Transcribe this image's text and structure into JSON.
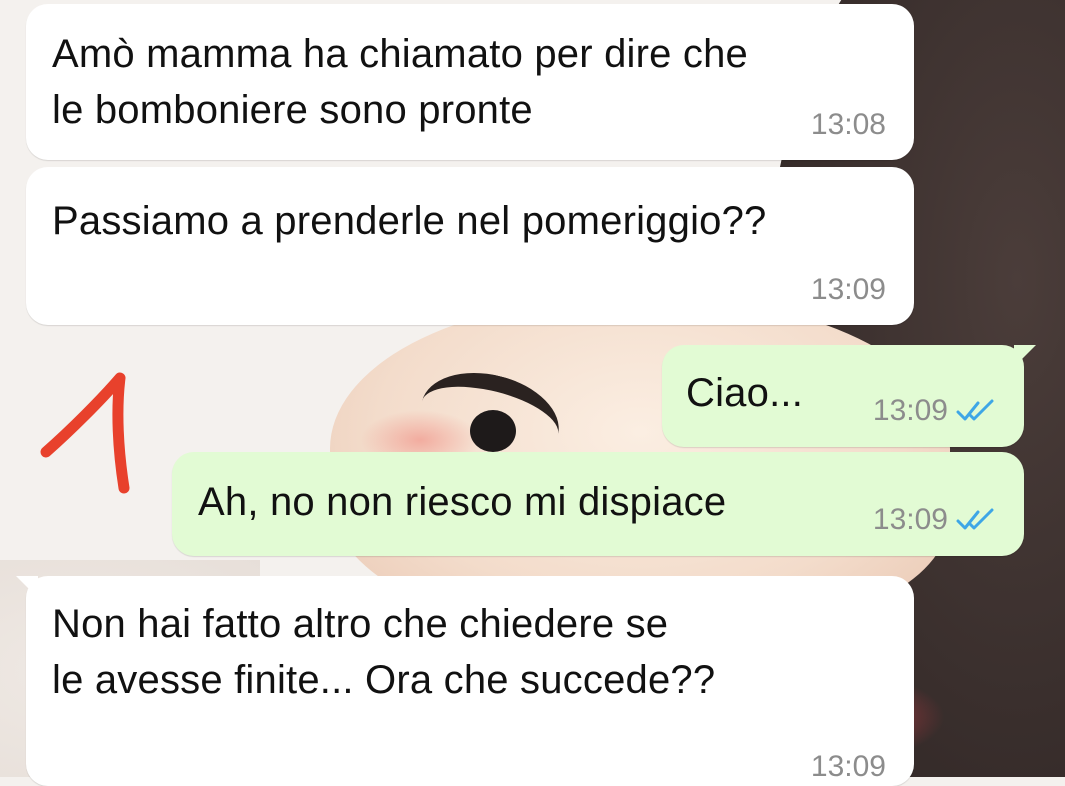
{
  "messages": [
    {
      "direction": "incoming",
      "text_line1": "Amò mamma ha chiamato per dire che",
      "text_line2": "le bomboniere sono pronte",
      "time": "13:08"
    },
    {
      "direction": "incoming",
      "text_line1": "Passiamo a prenderle nel pomeriggio??",
      "time": "13:09"
    },
    {
      "direction": "outgoing",
      "text_line1": "Ciao...",
      "time": "13:09",
      "status_icon": "double-check-read-icon"
    },
    {
      "direction": "outgoing",
      "text_line1": "Ah, no non riesco mi dispiace",
      "time": "13:09",
      "status_icon": "double-check-read-icon"
    },
    {
      "direction": "incoming",
      "text_line1": "Non hai fatto altro che chiedere se",
      "text_line2": "le avesse finite... Ora che succede??",
      "time": "13:09"
    }
  ],
  "annotation": {
    "text": "1",
    "color": "#e8412c"
  },
  "colors": {
    "incoming_bubble": "#ffffff",
    "outgoing_bubble": "#e2fbd4",
    "read_check": "#3ea6e6",
    "timestamp": "#8c8c8c"
  }
}
